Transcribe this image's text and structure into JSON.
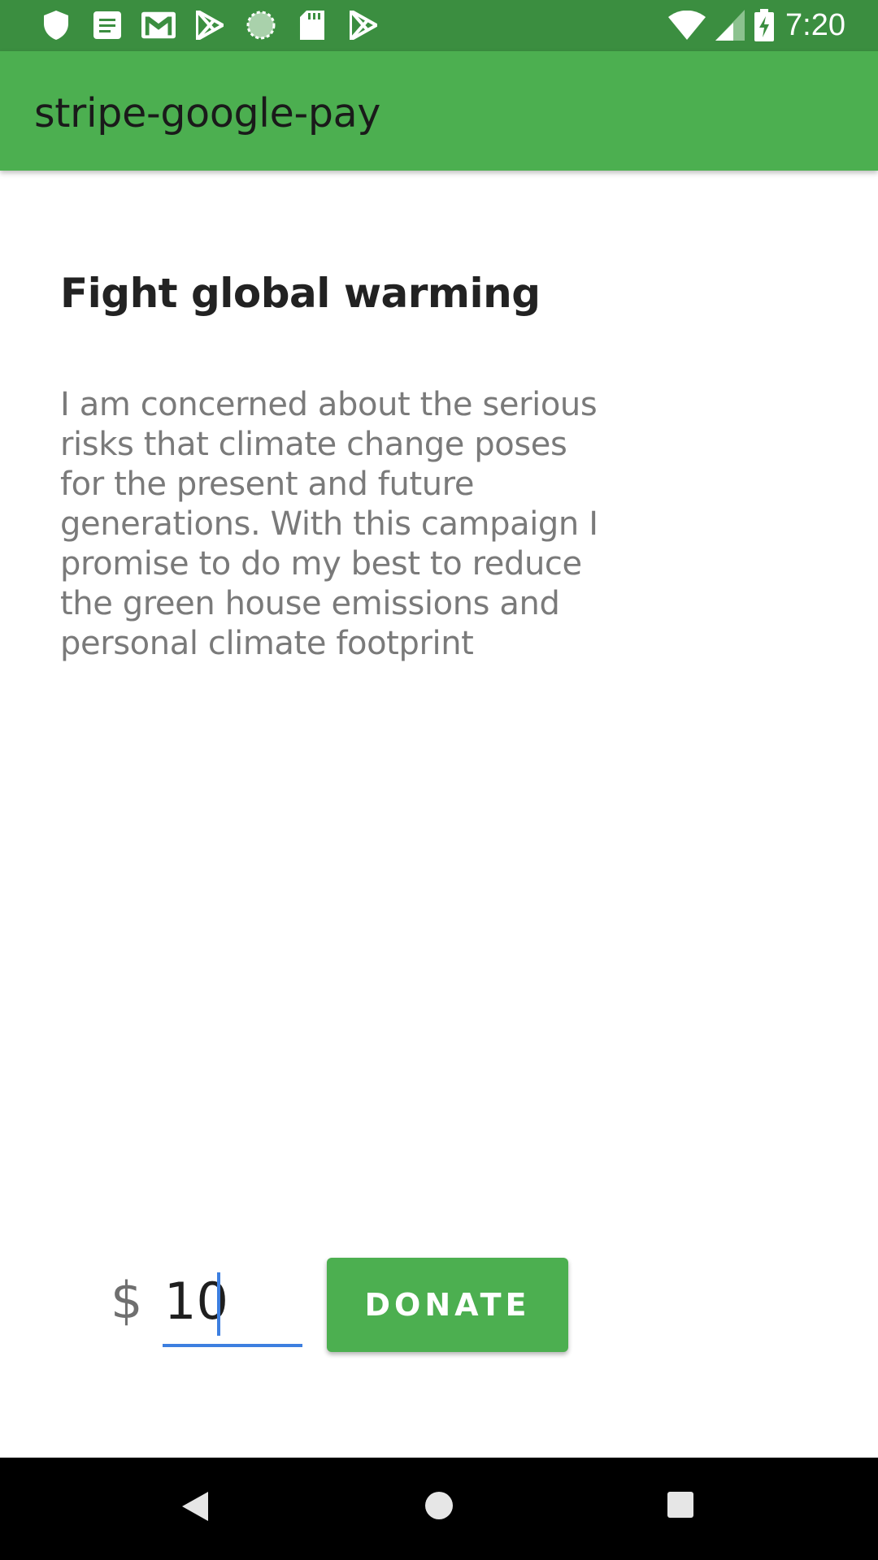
{
  "status_bar": {
    "time": "7:20",
    "left_icons": [
      "shield-icon",
      "notes-icon",
      "gmail-icon",
      "play-store-icon",
      "sync-icon",
      "sd-card-icon",
      "play-store-icon"
    ],
    "right_icons": [
      "wifi-icon",
      "cell-signal-icon",
      "battery-charging-icon"
    ],
    "background_color": "#3b8e40"
  },
  "app_bar": {
    "title": "stripe-google-pay",
    "background_color": "#4caf50"
  },
  "campaign": {
    "title": "Fight global warming",
    "description": "I am concerned about the serious risks that climate change poses for the present and future generations. With this campaign I promise to do my best to reduce the green house emissions and personal climate footprint"
  },
  "donation": {
    "currency_symbol": "$",
    "amount_value": "10",
    "button_label": "DONATE",
    "accent_color": "#3d7fe0"
  },
  "nav_bar": {
    "icons": [
      "back-icon",
      "home-icon",
      "recents-icon"
    ]
  }
}
